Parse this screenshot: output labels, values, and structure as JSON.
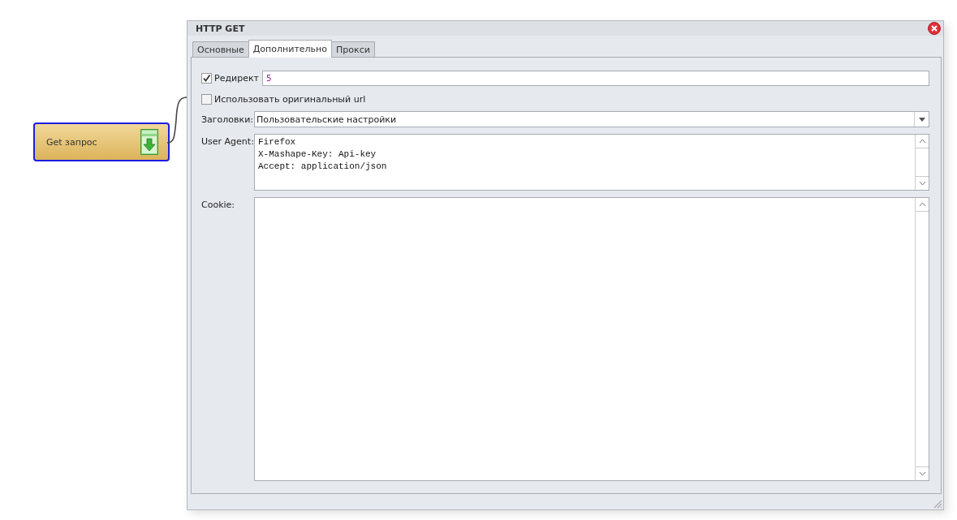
{
  "node": {
    "label": "Get запрос"
  },
  "window": {
    "title": "HTTP GET"
  },
  "tabs": [
    {
      "label": "Основные",
      "selected": false
    },
    {
      "label": "Дополнительно",
      "selected": true
    },
    {
      "label": "Прокси",
      "selected": false
    }
  ],
  "redirect": {
    "label": "Редирект",
    "checked": true,
    "value": "5"
  },
  "original_url": {
    "label": "Использовать оригинальный url",
    "checked": false
  },
  "headers": {
    "label": "Заголовки:",
    "value": "Пользовательские настройки"
  },
  "user_agent": {
    "label": "User Agent:",
    "lines": [
      "Firefox",
      "X-Mashape-Key: Api-key",
      "Accept: application/json"
    ]
  },
  "cookie": {
    "label": "Cookie:"
  }
}
